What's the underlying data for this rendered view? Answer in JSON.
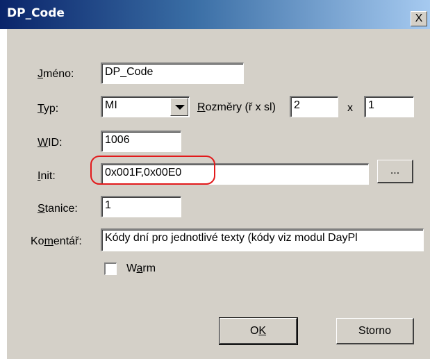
{
  "window": {
    "title": "DP_Code",
    "close_glyph": "X"
  },
  "labels": {
    "jmeno": {
      "key": "J",
      "rest": "méno:"
    },
    "typ": {
      "key": "T",
      "rest": "yp:"
    },
    "rozmery": {
      "key": "R",
      "rest": "ozměry (ř x sl)"
    },
    "x": "x",
    "wid": {
      "pre": "",
      "key": "W",
      "rest": "ID:"
    },
    "init": {
      "key": "I",
      "rest": "nit:"
    },
    "stanice": {
      "key": "S",
      "rest": "tanice:"
    },
    "komentar": {
      "pre": "Ko",
      "key": "m",
      "rest": "entář:"
    }
  },
  "fields": {
    "jmeno": "DP_Code",
    "typ": "MI",
    "rozmery_r": "2",
    "rozmery_sl": "1",
    "wid": "1006",
    "init": "0x001F,0x00E0",
    "stanice": "1",
    "komentar": "Kódy dní pro jednotlivé texty (kódy viz modul DayPl"
  },
  "checkbox_warm": {
    "pre": "W",
    "key": "a",
    "rest": "rm",
    "checked": false
  },
  "buttons": {
    "browse": "...",
    "ok": {
      "pre": "O",
      "key": "K",
      "rest": ""
    },
    "storno": "Storno"
  },
  "colors": {
    "highlight": "#e2191b",
    "dialog_bg": "#d4d0c8",
    "title_start": "#0a246a",
    "title_end": "#a6caf0"
  }
}
